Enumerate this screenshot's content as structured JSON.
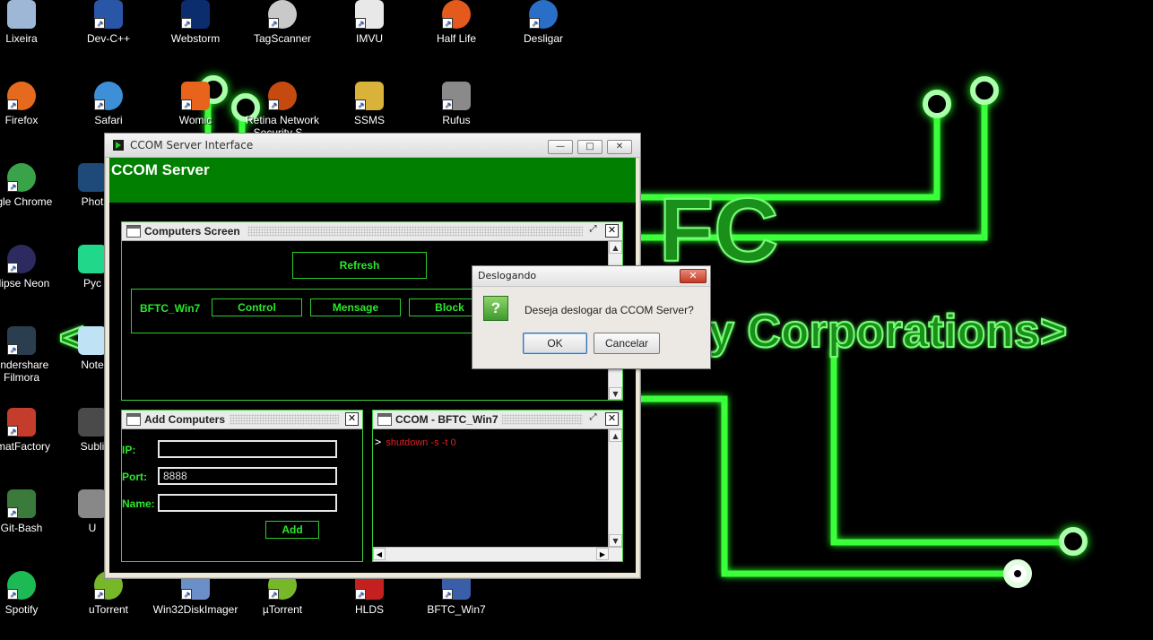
{
  "wallpaper": {
    "line1": "FC",
    "line2": "<",
    "line3": "y Corporations>"
  },
  "desktop_icons": [
    {
      "label": "Lixeira",
      "icon": "recycle-bin-icon",
      "color": "#9fb7d6"
    },
    {
      "label": "Dev-C++",
      "icon": "devcpp-icon",
      "color": "#2a56a8"
    },
    {
      "label": "Webstorm",
      "icon": "webstorm-icon",
      "color": "#0b2d6e"
    },
    {
      "label": "TagScanner",
      "icon": "magnifier-icon",
      "color": "#c9c9c9"
    },
    {
      "label": "IMVU",
      "icon": "imvu-icon",
      "color": "#e8e8e8"
    },
    {
      "label": "Half Life",
      "icon": "half-life-icon",
      "color": "#e35a1c"
    },
    {
      "label": "Desligar",
      "icon": "power-icon",
      "color": "#2a6fc7"
    },
    {
      "label": "Firefox",
      "icon": "firefox-icon",
      "color": "#e66a1d"
    },
    {
      "label": "Safari",
      "icon": "safari-icon",
      "color": "#3d8fd8"
    },
    {
      "label": "Womic",
      "icon": "womic-icon",
      "color": "#e8641c"
    },
    {
      "label": "Retina Network Security S...",
      "icon": "retina-icon",
      "color": "#c44a10"
    },
    {
      "label": "SSMS",
      "icon": "ssms-icon",
      "color": "#d9b23a"
    },
    {
      "label": "Rufus",
      "icon": "usb-icon",
      "color": "#8a8a8a"
    },
    {
      "label": "ogle Chrome",
      "icon": "chrome-icon",
      "color": "#3aa34a"
    },
    {
      "label": "Phot",
      "icon": "photoshop-icon",
      "color": "#1e4a7a"
    },
    {
      "label": "clipse Neon",
      "icon": "eclipse-icon",
      "color": "#2c2a5e"
    },
    {
      "label": "Pyc",
      "icon": "pycharm-icon",
      "color": "#21d789"
    },
    {
      "label": "ondershare Filmora",
      "icon": "filmora-icon",
      "color": "#2b3e4f"
    },
    {
      "label": "Note",
      "icon": "notepad-icon",
      "color": "#bfe3f5"
    },
    {
      "label": "rmatFactory",
      "icon": "formatfactory-icon",
      "color": "#c43c2c"
    },
    {
      "label": "Subli",
      "icon": "sublime-icon",
      "color": "#4a4a4a"
    },
    {
      "label": "Git-Bash",
      "icon": "git-bash-icon",
      "color": "#3a7a3a"
    },
    {
      "label": "U",
      "icon": "u-icon",
      "color": "#888888"
    },
    {
      "label": "Spotify",
      "icon": "spotify-icon",
      "color": "#1db954"
    },
    {
      "label": "uTorrent",
      "icon": "utorrent-icon",
      "color": "#76b82a"
    },
    {
      "label": "Win32DiskImager",
      "icon": "disk-imager-icon",
      "color": "#6a8fc9"
    },
    {
      "label": "µTorrent",
      "icon": "utorrent-icon",
      "color": "#76b82a"
    },
    {
      "label": "HLDS",
      "icon": "hlds-icon",
      "color": "#c42020"
    },
    {
      "label": "BFTC_Win7",
      "icon": "bftc-icon",
      "color": "#3a5ea8"
    }
  ],
  "main_window": {
    "title": "CCOM Server Interface",
    "header_title": "CCOM Server",
    "controls": {
      "minimize": "—",
      "maximize": "□",
      "close": "✕"
    }
  },
  "computers_screen": {
    "title": "Computers Screen",
    "refresh_label": "Refresh",
    "computer": {
      "name": "BFTC_Win7",
      "control_label": "Control",
      "message_label": "Mensage",
      "block_label": "Block"
    }
  },
  "add_computers": {
    "title": "Add Computers",
    "ip_label": "IP:",
    "ip_value": "",
    "port_label": "Port:",
    "port_value": "8888",
    "name_label": "Name:",
    "name_value": "",
    "add_label": "Add"
  },
  "console": {
    "title": "CCOM - BFTC_Win7",
    "prompt": ">",
    "command": "shutdown -s -t 0",
    "command_color": "#e02020"
  },
  "dialog": {
    "title": "Deslogando",
    "close": "✕",
    "question_mark": "?",
    "message": "Deseja deslogar da CCOM Server?",
    "ok_label": "OK",
    "cancel_label": "Cancelar"
  }
}
